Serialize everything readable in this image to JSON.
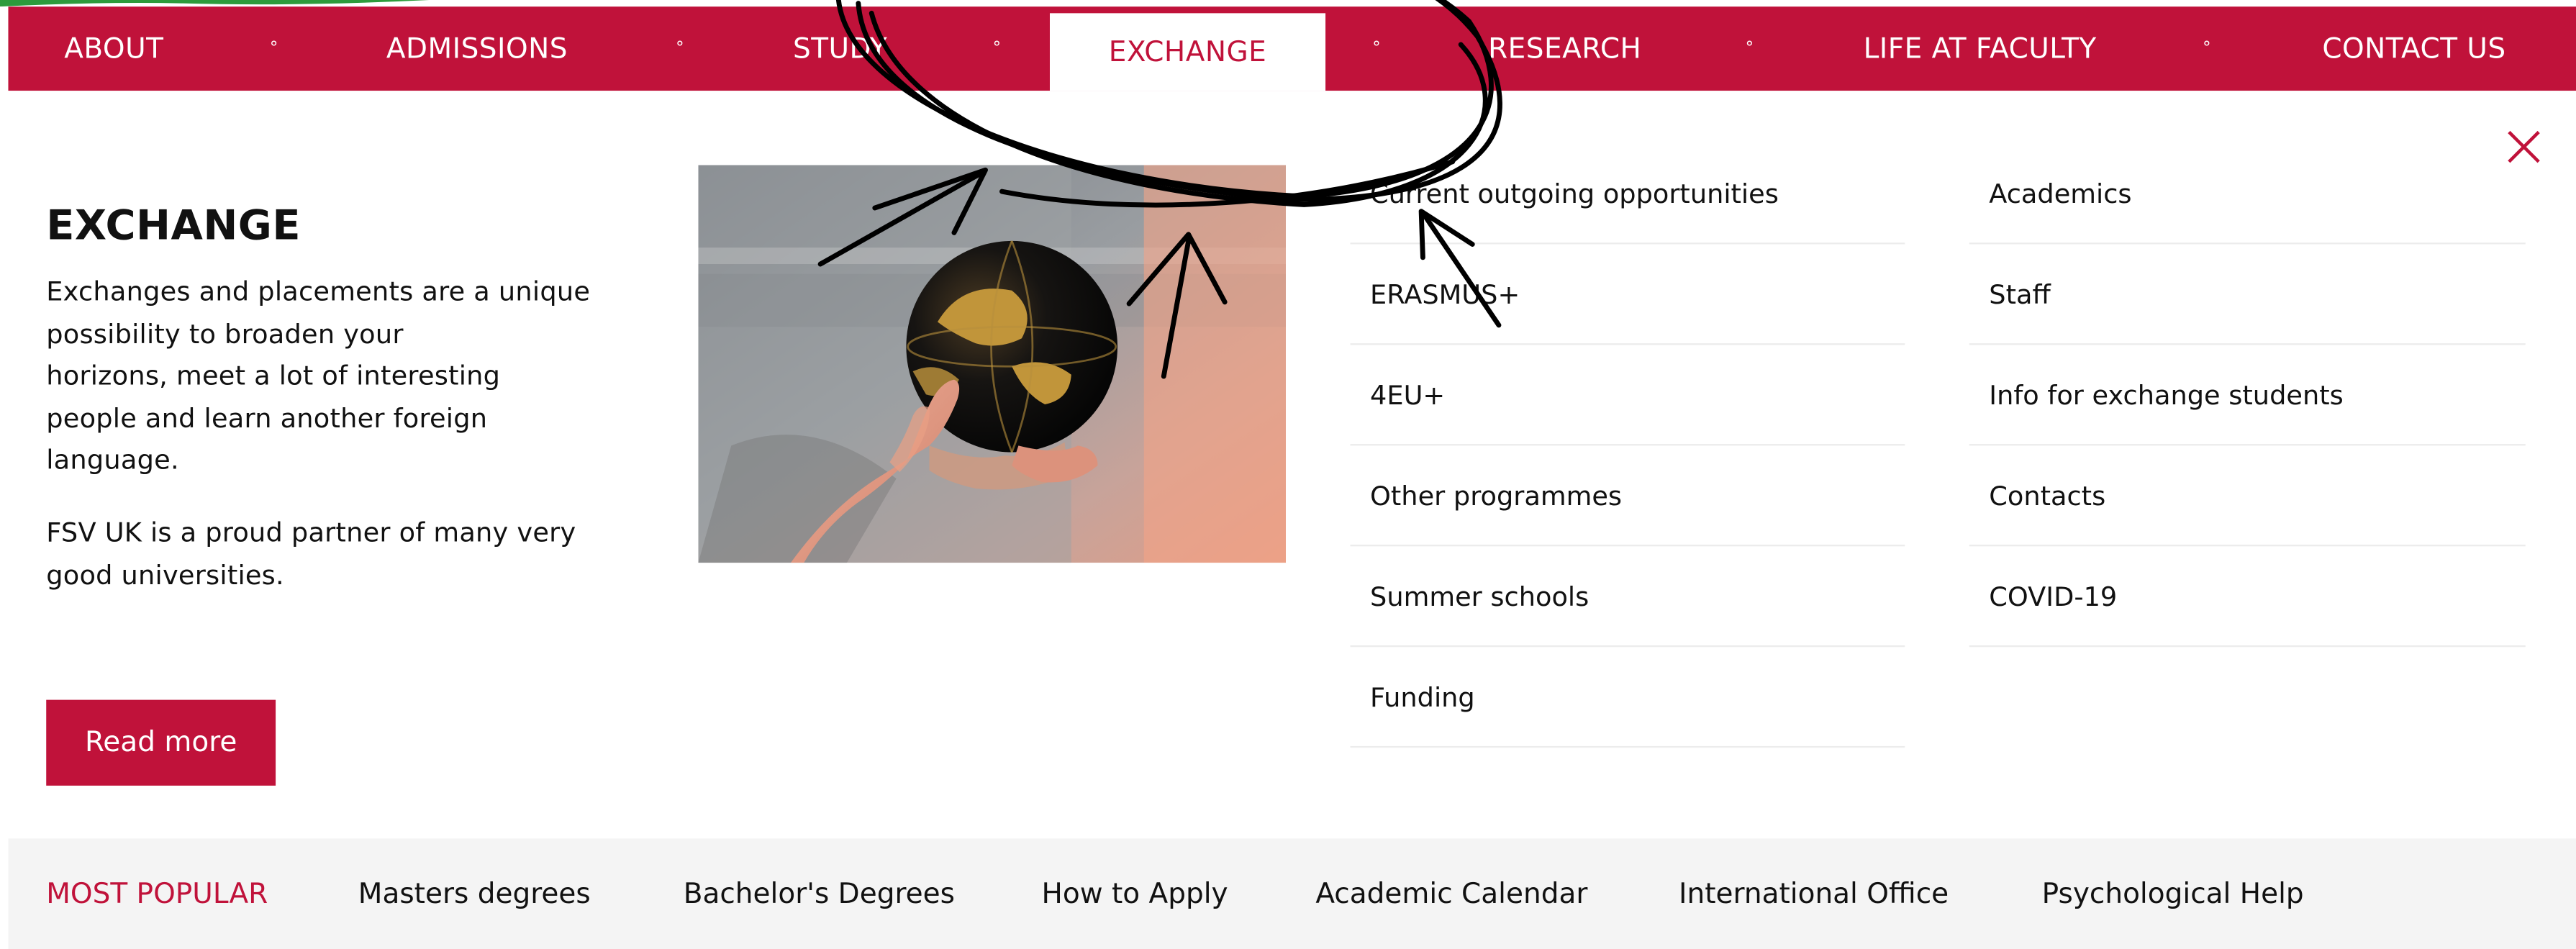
{
  "nav": {
    "items": [
      {
        "label": "ABOUT"
      },
      {
        "label": "ADMISSIONS"
      },
      {
        "label": "STUDY"
      },
      {
        "label": "EXCHANGE",
        "active": true
      },
      {
        "label": "RESEARCH"
      },
      {
        "label": "LIFE AT FACULTY"
      },
      {
        "label": "CONTACT US"
      }
    ],
    "separator": "°"
  },
  "panel": {
    "title": "EXCHANGE",
    "paragraphs": [
      "Exchanges and placements are a unique\npossibility to broaden your\nhorizons, meet a lot of interesting\npeople and learn another foreign\nlanguage.",
      "FSV UK is a proud partner of many very\ngood universities."
    ],
    "button_label": "Read more",
    "image_alt": "hand-pointing-at-globe"
  },
  "links": {
    "column1": [
      "Current outgoing opportunities",
      "ERASMUS+",
      "4EU+",
      "Other programmes",
      "Summer schools",
      "Funding"
    ],
    "column2": [
      "Academics",
      "Staff",
      "Info for exchange students",
      "Contacts",
      "COVID-19"
    ]
  },
  "close_icon": "close-icon",
  "popular": {
    "label": "MOST POPULAR",
    "items": [
      "Masters degrees",
      "Bachelor's Degrees",
      "How to Apply",
      "Academic Calendar",
      "International Office",
      "Psychological Help"
    ]
  },
  "colors": {
    "brand": "#c0123a",
    "active_text": "#c0123a",
    "panel_background": "#ffffff",
    "popular_background": "#f4f4f4"
  }
}
